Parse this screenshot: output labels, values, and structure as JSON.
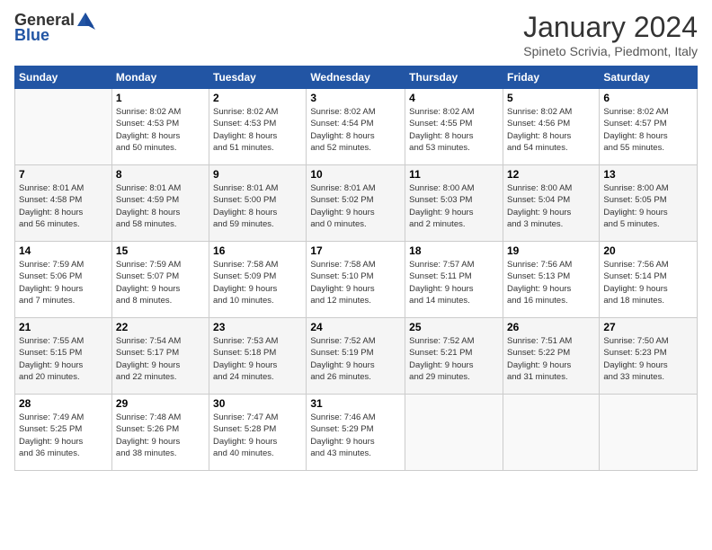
{
  "logo": {
    "general": "General",
    "blue": "Blue"
  },
  "header": {
    "title": "January 2024",
    "subtitle": "Spineto Scrivia, Piedmont, Italy"
  },
  "weekdays": [
    "Sunday",
    "Monday",
    "Tuesday",
    "Wednesday",
    "Thursday",
    "Friday",
    "Saturday"
  ],
  "weeks": [
    [
      {
        "day": "",
        "info": ""
      },
      {
        "day": "1",
        "info": "Sunrise: 8:02 AM\nSunset: 4:53 PM\nDaylight: 8 hours\nand 50 minutes."
      },
      {
        "day": "2",
        "info": "Sunrise: 8:02 AM\nSunset: 4:53 PM\nDaylight: 8 hours\nand 51 minutes."
      },
      {
        "day": "3",
        "info": "Sunrise: 8:02 AM\nSunset: 4:54 PM\nDaylight: 8 hours\nand 52 minutes."
      },
      {
        "day": "4",
        "info": "Sunrise: 8:02 AM\nSunset: 4:55 PM\nDaylight: 8 hours\nand 53 minutes."
      },
      {
        "day": "5",
        "info": "Sunrise: 8:02 AM\nSunset: 4:56 PM\nDaylight: 8 hours\nand 54 minutes."
      },
      {
        "day": "6",
        "info": "Sunrise: 8:02 AM\nSunset: 4:57 PM\nDaylight: 8 hours\nand 55 minutes."
      }
    ],
    [
      {
        "day": "7",
        "info": "Sunrise: 8:01 AM\nSunset: 4:58 PM\nDaylight: 8 hours\nand 56 minutes."
      },
      {
        "day": "8",
        "info": "Sunrise: 8:01 AM\nSunset: 4:59 PM\nDaylight: 8 hours\nand 58 minutes."
      },
      {
        "day": "9",
        "info": "Sunrise: 8:01 AM\nSunset: 5:00 PM\nDaylight: 8 hours\nand 59 minutes."
      },
      {
        "day": "10",
        "info": "Sunrise: 8:01 AM\nSunset: 5:02 PM\nDaylight: 9 hours\nand 0 minutes."
      },
      {
        "day": "11",
        "info": "Sunrise: 8:00 AM\nSunset: 5:03 PM\nDaylight: 9 hours\nand 2 minutes."
      },
      {
        "day": "12",
        "info": "Sunrise: 8:00 AM\nSunset: 5:04 PM\nDaylight: 9 hours\nand 3 minutes."
      },
      {
        "day": "13",
        "info": "Sunrise: 8:00 AM\nSunset: 5:05 PM\nDaylight: 9 hours\nand 5 minutes."
      }
    ],
    [
      {
        "day": "14",
        "info": "Sunrise: 7:59 AM\nSunset: 5:06 PM\nDaylight: 9 hours\nand 7 minutes."
      },
      {
        "day": "15",
        "info": "Sunrise: 7:59 AM\nSunset: 5:07 PM\nDaylight: 9 hours\nand 8 minutes."
      },
      {
        "day": "16",
        "info": "Sunrise: 7:58 AM\nSunset: 5:09 PM\nDaylight: 9 hours\nand 10 minutes."
      },
      {
        "day": "17",
        "info": "Sunrise: 7:58 AM\nSunset: 5:10 PM\nDaylight: 9 hours\nand 12 minutes."
      },
      {
        "day": "18",
        "info": "Sunrise: 7:57 AM\nSunset: 5:11 PM\nDaylight: 9 hours\nand 14 minutes."
      },
      {
        "day": "19",
        "info": "Sunrise: 7:56 AM\nSunset: 5:13 PM\nDaylight: 9 hours\nand 16 minutes."
      },
      {
        "day": "20",
        "info": "Sunrise: 7:56 AM\nSunset: 5:14 PM\nDaylight: 9 hours\nand 18 minutes."
      }
    ],
    [
      {
        "day": "21",
        "info": "Sunrise: 7:55 AM\nSunset: 5:15 PM\nDaylight: 9 hours\nand 20 minutes."
      },
      {
        "day": "22",
        "info": "Sunrise: 7:54 AM\nSunset: 5:17 PM\nDaylight: 9 hours\nand 22 minutes."
      },
      {
        "day": "23",
        "info": "Sunrise: 7:53 AM\nSunset: 5:18 PM\nDaylight: 9 hours\nand 24 minutes."
      },
      {
        "day": "24",
        "info": "Sunrise: 7:52 AM\nSunset: 5:19 PM\nDaylight: 9 hours\nand 26 minutes."
      },
      {
        "day": "25",
        "info": "Sunrise: 7:52 AM\nSunset: 5:21 PM\nDaylight: 9 hours\nand 29 minutes."
      },
      {
        "day": "26",
        "info": "Sunrise: 7:51 AM\nSunset: 5:22 PM\nDaylight: 9 hours\nand 31 minutes."
      },
      {
        "day": "27",
        "info": "Sunrise: 7:50 AM\nSunset: 5:23 PM\nDaylight: 9 hours\nand 33 minutes."
      }
    ],
    [
      {
        "day": "28",
        "info": "Sunrise: 7:49 AM\nSunset: 5:25 PM\nDaylight: 9 hours\nand 36 minutes."
      },
      {
        "day": "29",
        "info": "Sunrise: 7:48 AM\nSunset: 5:26 PM\nDaylight: 9 hours\nand 38 minutes."
      },
      {
        "day": "30",
        "info": "Sunrise: 7:47 AM\nSunset: 5:28 PM\nDaylight: 9 hours\nand 40 minutes."
      },
      {
        "day": "31",
        "info": "Sunrise: 7:46 AM\nSunset: 5:29 PM\nDaylight: 9 hours\nand 43 minutes."
      },
      {
        "day": "",
        "info": ""
      },
      {
        "day": "",
        "info": ""
      },
      {
        "day": "",
        "info": ""
      }
    ]
  ]
}
